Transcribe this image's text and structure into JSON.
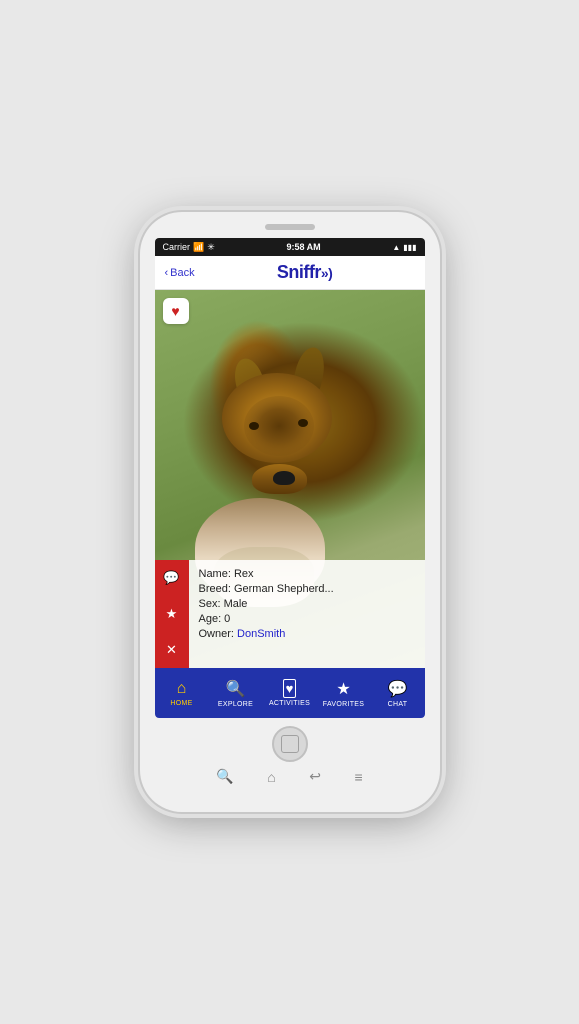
{
  "phone": {
    "status_bar": {
      "carrier": "Carrier",
      "time": "9:58 AM",
      "signal": "wifi"
    },
    "nav": {
      "back_label": "Back",
      "title": "Sniffr",
      "title_suffix": "»)"
    },
    "dog": {
      "heart_icon": "♥",
      "name_label": "Name: Rex",
      "breed_label": "Breed: German Shepherd...",
      "sex_label": "Sex: Male",
      "age_label": "Age: 0",
      "owner_prefix": "Owner: ",
      "owner_name": "DonSmith"
    },
    "action_buttons": {
      "chat_icon": "💬",
      "star_icon": "★",
      "close_icon": "✕"
    },
    "bottom_nav": {
      "items": [
        {
          "id": "home",
          "label": "HOME",
          "icon": "⌂",
          "active": true
        },
        {
          "id": "explore",
          "label": "EXPLORE",
          "icon": "⊕",
          "active": false
        },
        {
          "id": "activities",
          "label": "ACTIVITIES",
          "icon": "⬜",
          "active": false
        },
        {
          "id": "favorites",
          "label": "FAVORITES",
          "icon": "★",
          "active": false
        },
        {
          "id": "chat",
          "label": "CHAT",
          "icon": "💬",
          "active": false
        }
      ]
    },
    "hardware_nav": {
      "search_icon": "🔍",
      "home_icon": "⌂",
      "back_icon": "↩",
      "menu_icon": "≡"
    }
  }
}
